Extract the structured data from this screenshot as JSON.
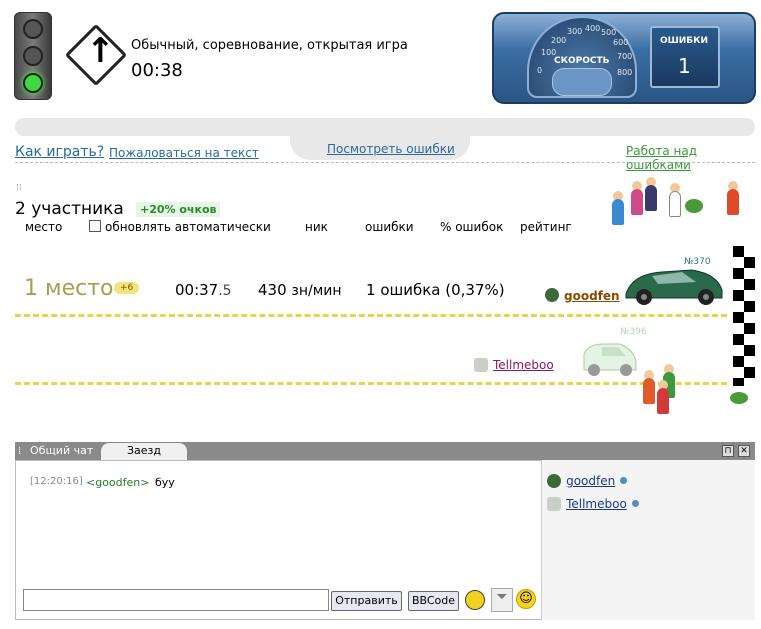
{
  "game": {
    "title": "Обычный, соревнование, открытая игра",
    "timer": "00:38"
  },
  "speedometer": {
    "label": "СКОРОСТЬ",
    "scale": [
      "0",
      "100",
      "200",
      "300",
      "400",
      "500",
      "600",
      "700",
      "800"
    ]
  },
  "errors_panel": {
    "label": "ОШИБКИ",
    "count": "1"
  },
  "links": {
    "how_to_play": "Как играть?",
    "complain": "Пожаловаться на текст",
    "view_errors": "Посмотреть ошибки",
    "work_on_errors": "Работа над ошибками"
  },
  "participants": {
    "count_label": "2 участника",
    "bonus": "+20% очков",
    "columns": [
      "место",
      "обновлять автоматически",
      "ник",
      "ошибки",
      "% ошибок",
      "рейтинг"
    ]
  },
  "race": {
    "players": [
      {
        "place": "1 место",
        "bonus_badge": "+6",
        "time_main": "00:37",
        "time_frac": ".5",
        "speed": "430",
        "speed_unit": "зн/мин",
        "errors": "1",
        "errors_text": "ошибка (0,37%)",
        "nick": "goodfen",
        "car_number": "№370"
      },
      {
        "nick": "Tellmeboo",
        "car_number": "№396"
      }
    ]
  },
  "chat": {
    "tabs": [
      "Общий чат",
      "Заезд"
    ],
    "messages": [
      {
        "time": "[12:20:16]",
        "nick": "<goodfen>",
        "text": "буу"
      }
    ],
    "send_label": "Отправить",
    "bbcode_label": "BBCode",
    "users": [
      "goodfen",
      "Tellmeboo"
    ]
  },
  "colors": {
    "accent_link": "#2a6a9a",
    "green_link": "#3a9a3a",
    "track_dash": "#e8d34a",
    "place_color": "#a4a050"
  }
}
